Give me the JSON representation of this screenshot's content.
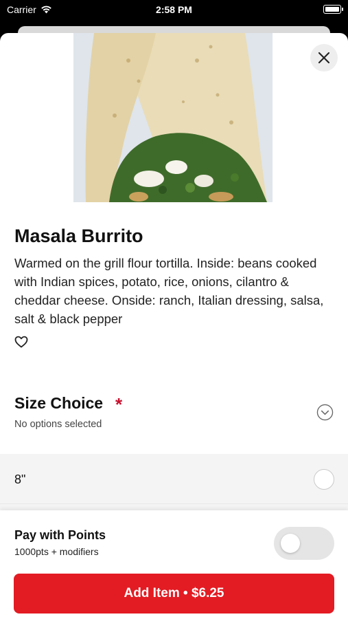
{
  "status_bar": {
    "carrier": "Carrier",
    "time": "2:58 PM"
  },
  "item": {
    "name": "Masala Burrito",
    "description": "Warmed on the grill flour tortilla. Inside: beans cooked with Indian spices, potato, rice, onions, cilantro & cheddar cheese. Onside: ranch, Italian dressing, salsa, salt & black pepper"
  },
  "size_choice": {
    "title": "Size Choice",
    "required_marker": "*",
    "subtitle": "No options selected",
    "options": [
      {
        "label": "8\""
      }
    ]
  },
  "points": {
    "title": "Pay with Points",
    "subtitle": "1000pts + modifiers",
    "enabled": false
  },
  "add_button": {
    "label": "Add Item • $6.25"
  },
  "colors": {
    "accent": "#e31b23",
    "required": "#c8102e",
    "option_bg": "#f4f4f4"
  }
}
